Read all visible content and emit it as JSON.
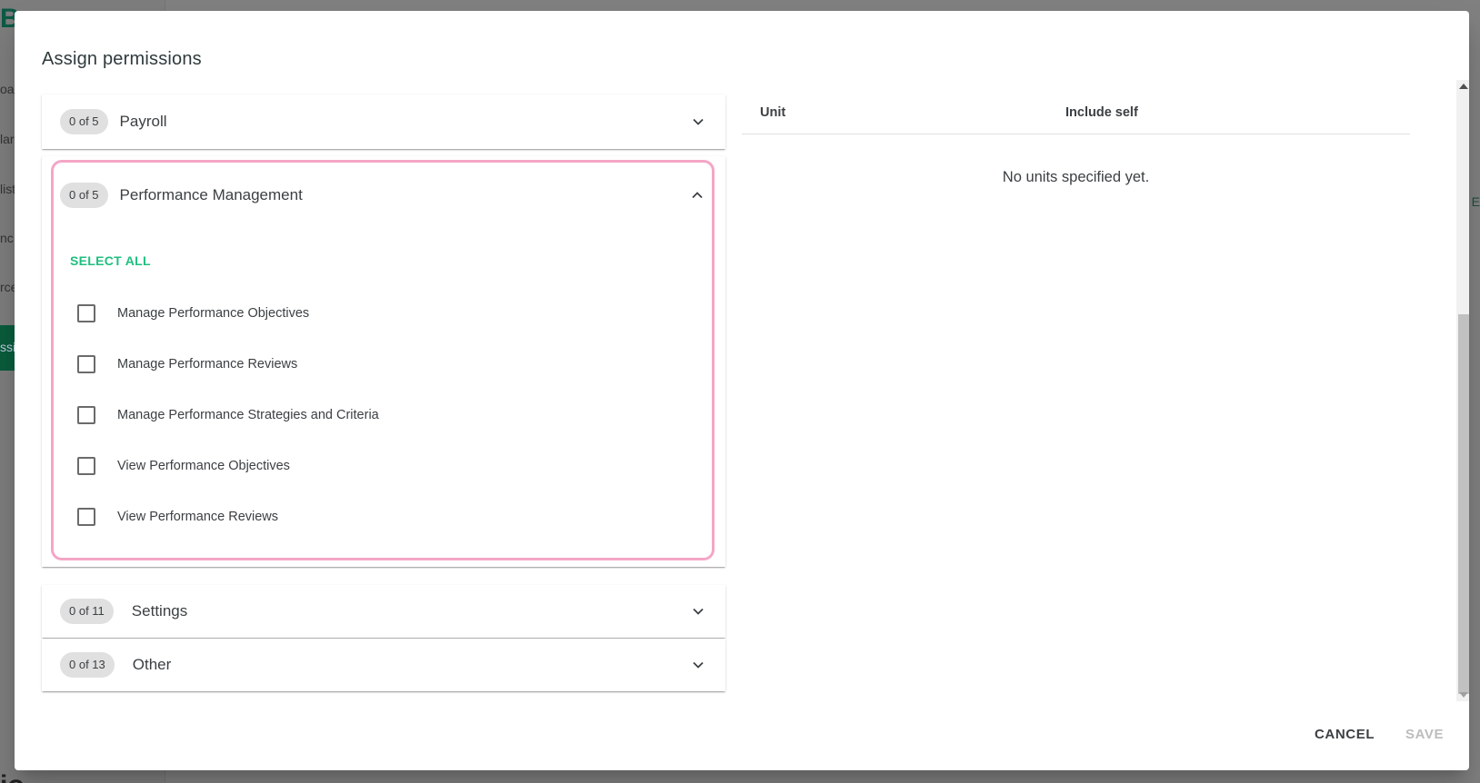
{
  "background": {
    "logo_letter": "B",
    "nav_fragments": [
      "oa",
      "lar",
      "list",
      "nc",
      "rce"
    ],
    "active_fragment": "ssi",
    "bottom_fragment": "io",
    "right_tab_fragment": "E"
  },
  "dialog": {
    "title": "Assign permissions",
    "groups": [
      {
        "count": "0 of 5",
        "title": "Payroll",
        "expanded": false
      },
      {
        "count": "0 of 5",
        "title": "Performance Management",
        "expanded": true,
        "select_all_label": "SELECT ALL",
        "permissions": [
          {
            "label": "Manage Performance Objectives",
            "checked": false
          },
          {
            "label": "Manage Performance Reviews",
            "checked": false
          },
          {
            "label": "Manage Performance Strategies and Criteria",
            "checked": false
          },
          {
            "label": "View Performance Objectives",
            "checked": false
          },
          {
            "label": "View Performance Reviews",
            "checked": false
          }
        ]
      },
      {
        "count": "0 of 11",
        "title": "Settings",
        "expanded": false
      },
      {
        "count": "0 of 13",
        "title": "Other",
        "expanded": false
      }
    ],
    "units_table": {
      "columns": [
        "Unit",
        "Include self"
      ],
      "empty_message": "No units specified yet."
    },
    "actions": {
      "cancel_label": "CANCEL",
      "save_label": "SAVE"
    }
  }
}
